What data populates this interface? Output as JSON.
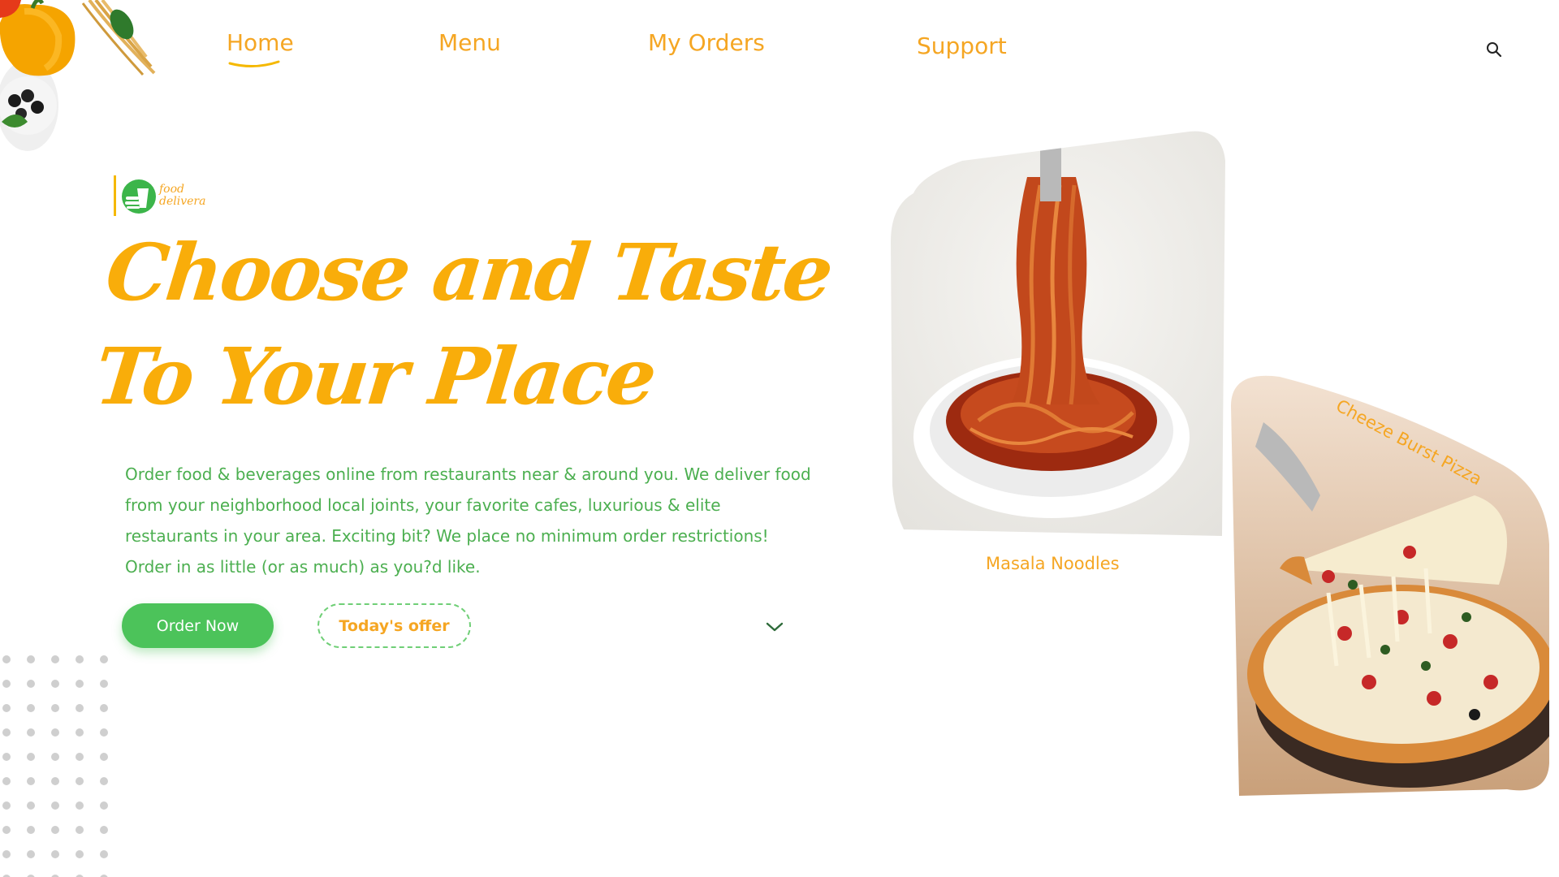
{
  "nav": {
    "items": [
      {
        "label": "Home",
        "active": true
      },
      {
        "label": "Menu"
      },
      {
        "label": "My Orders"
      },
      {
        "label": "Support"
      }
    ],
    "search_icon": "search-icon"
  },
  "brand": {
    "line1": "food",
    "line2": "delivera"
  },
  "hero": {
    "headline_line1": "Choose and Taste",
    "headline_line2": "To Your Place",
    "description": "Order food & beverages online from restaurants near & around you. We deliver food from your neighborhood local joints, your favorite cafes, luxurious & elite restaurants in your area. Exciting bit? We place no minimum order restrictions! Order in as little (or as much) as you?d like.",
    "order_button": "Order Now",
    "offer_button": "Today's offer",
    "scroll_icon": "chevron-down-icon"
  },
  "dishes": [
    {
      "name": "Masala Noodles"
    },
    {
      "name": "Cheeze Burst Pizza"
    }
  ],
  "colors": {
    "accent": "#f5a623",
    "green": "#4cc35a",
    "text_green": "#4caf50"
  }
}
